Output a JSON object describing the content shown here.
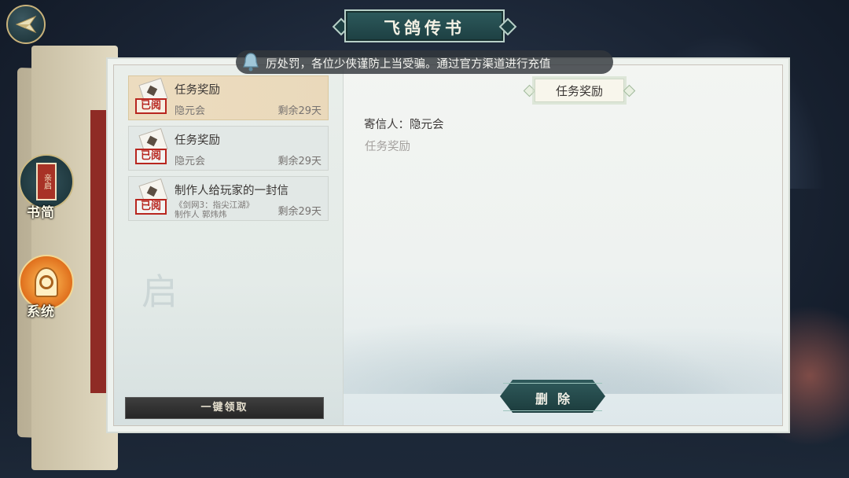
{
  "header": {
    "title": "飞鸽传书"
  },
  "notice": {
    "text": "厉处罚，各位少侠谨防上当受骗。通过官方渠道进行充值"
  },
  "sidebar": {
    "items": [
      {
        "label": "书简",
        "icon": "letter-icon"
      },
      {
        "label": "系统",
        "icon": "system-bell-icon"
      }
    ]
  },
  "mail_list": {
    "items": [
      {
        "title": "任务奖励",
        "status_stamp": "已阅",
        "from": "隐元会",
        "remaining": "剩余29天",
        "selected": true
      },
      {
        "title": "任务奖励",
        "status_stamp": "已阅",
        "from": "隐元会",
        "remaining": "剩余29天",
        "selected": false
      },
      {
        "title": "制作人给玩家的一封信",
        "status_stamp": "已阅",
        "sub_line1": "《剑网3：指尖江湖》",
        "sub_line2": "制作人 郭炜炜",
        "remaining": "剩余29天",
        "selected": false
      }
    ],
    "collect_all_label": "一键领取"
  },
  "detail": {
    "tag": "任务奖励",
    "sender_line": "寄信人：隐元会",
    "body": "任务奖励",
    "delete_label": "删除"
  },
  "colors": {
    "accent_teal": "#1d3f42",
    "stamp_red": "#b8261f",
    "selected_bg": "#ecdcbf"
  }
}
